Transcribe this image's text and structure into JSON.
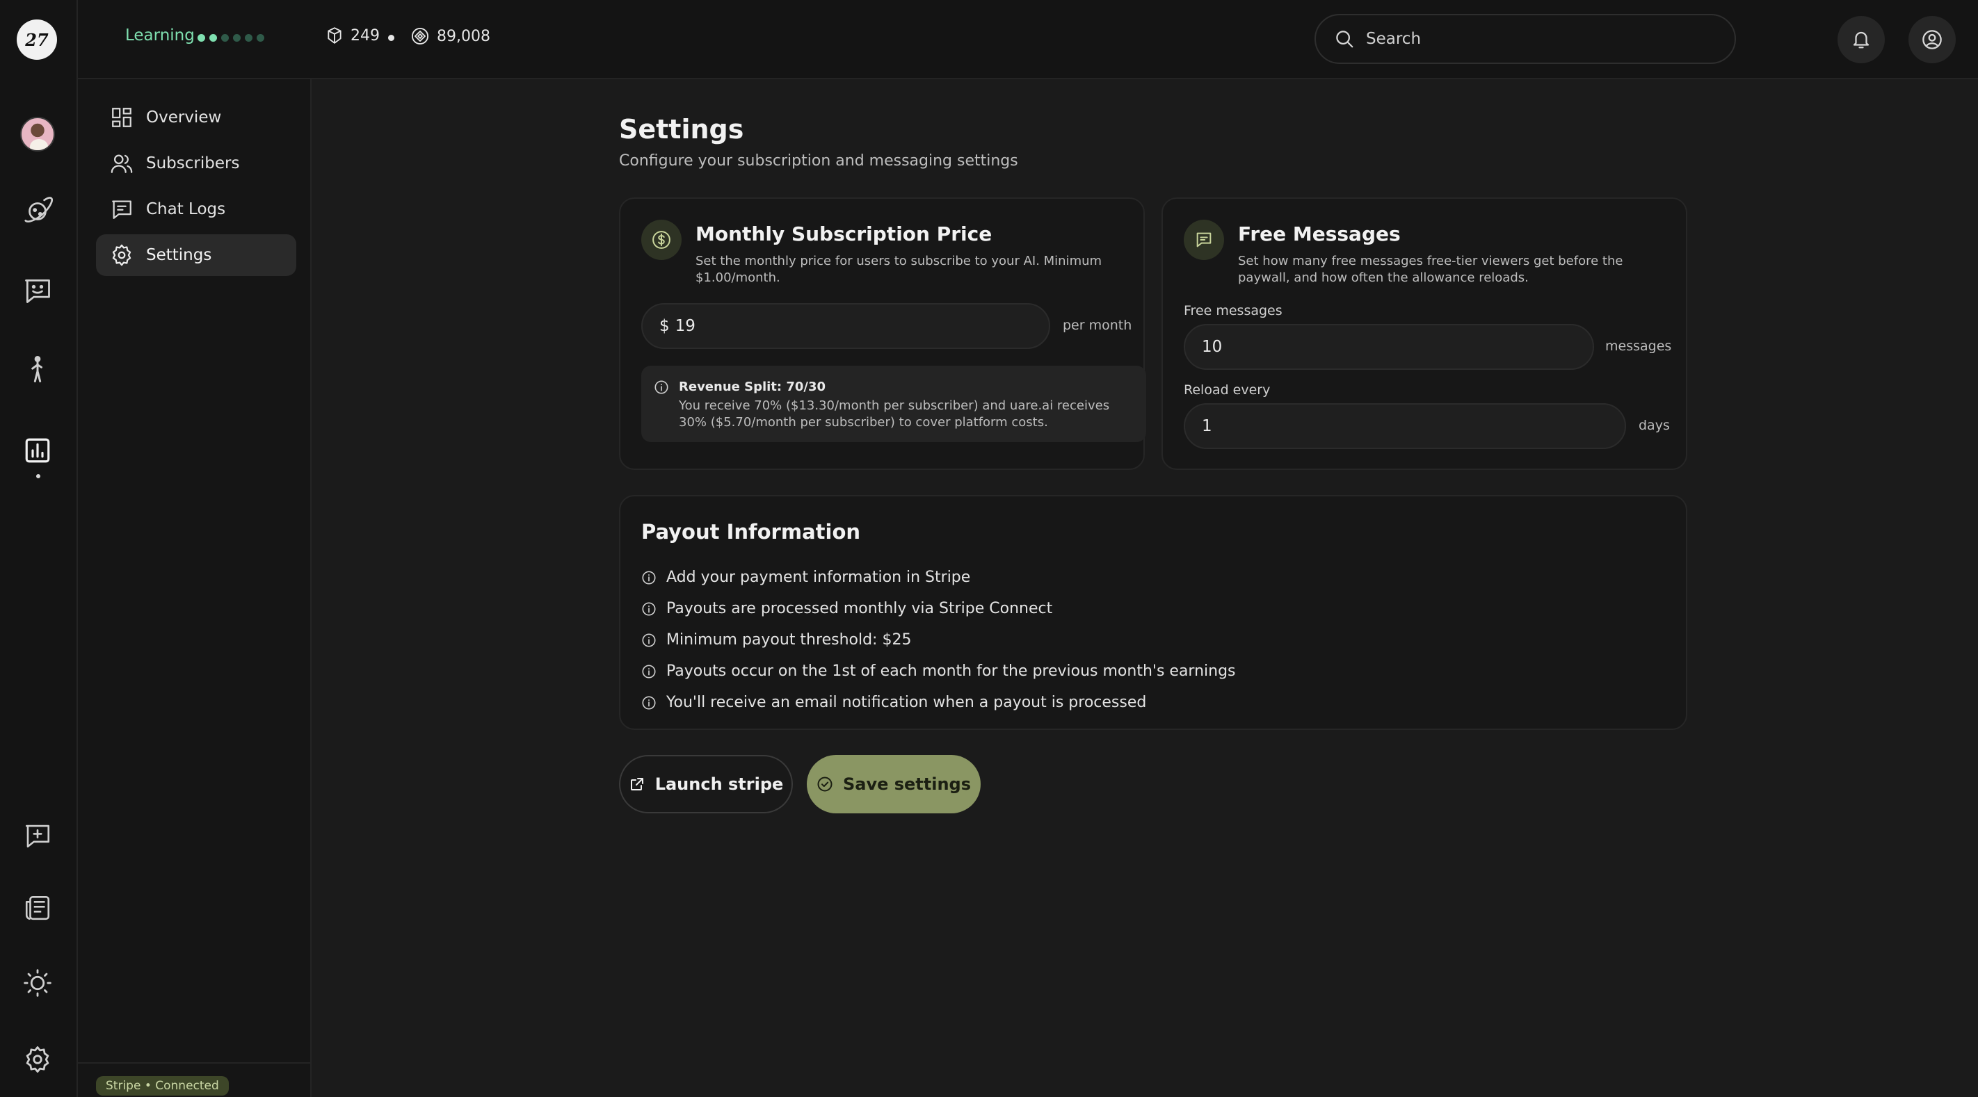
{
  "app": {
    "logo_text": "27"
  },
  "header": {
    "learning_label": "Learning",
    "progress_dots": [
      true,
      true,
      false,
      false,
      false,
      false
    ],
    "stat_primary": "249",
    "stat_secondary": "89,008",
    "search_placeholder": "Search"
  },
  "sidebar": {
    "items": [
      {
        "label": "Overview",
        "icon": "grid-icon",
        "active": false
      },
      {
        "label": "Subscribers",
        "icon": "users-icon",
        "active": false
      },
      {
        "label": "Chat Logs",
        "icon": "chat-icon",
        "active": false
      },
      {
        "label": "Settings",
        "icon": "gear-icon",
        "active": true
      }
    ],
    "footer_badge": "Stripe • Connected"
  },
  "page": {
    "title": "Settings",
    "subtitle": "Configure your subscription and messaging settings"
  },
  "subscription": {
    "title": "Monthly Subscription Price",
    "description": "Set the monthly price for users to subscribe to your AI. Minimum $1.00/month.",
    "currency": "$",
    "price": "19",
    "suffix": "per month",
    "note_title": "Revenue Split: 70/30",
    "note_text": "You receive 70% ($13.30/month per subscriber) and uare.ai receives 30% ($5.70/month per subscriber) to cover platform costs."
  },
  "free_messages": {
    "title": "Free Messages",
    "description": "Set how many free messages free-tier viewers get before the paywall, and how often the allowance reloads.",
    "count_label": "Free messages",
    "count_value": "10",
    "count_suffix": "messages",
    "reload_label": "Reload every",
    "reload_value": "1",
    "reload_suffix": "days"
  },
  "payout": {
    "title": "Payout Information",
    "items": [
      "Add your payment information in Stripe",
      "Payouts are processed monthly via Stripe Connect",
      "Minimum payout threshold: $25",
      "Payouts occur on the 1st of each month for the previous month's earnings",
      "You'll receive an email notification when a payout is processed"
    ]
  },
  "actions": {
    "launch_label": "Launch stripe",
    "save_label": "Save settings"
  },
  "colors": {
    "accent": "#8a9663",
    "learning": "#7fe0b0",
    "background": "#1b1b1b"
  }
}
